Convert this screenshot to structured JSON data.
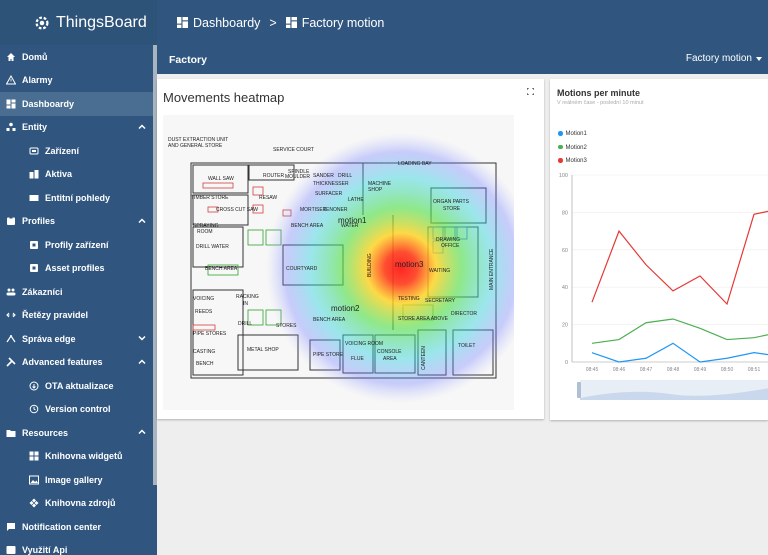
{
  "app": {
    "title": "ThingsBoard"
  },
  "breadcrumb": {
    "first": "Dashboardy",
    "separator": ">",
    "second": "Factory motion"
  },
  "colors": {
    "sidebar": "#305680",
    "active_item": "#4a6e92",
    "heat_red": "#ff2a2a",
    "motion1": "#2196f3",
    "motion2": "#4caf50",
    "motion3": "#e53935"
  },
  "sidebar": {
    "items": [
      {
        "label": "Domů",
        "icon": "home-icon"
      },
      {
        "label": "Alarmy",
        "icon": "warning-icon"
      },
      {
        "label": "Dashboardy",
        "icon": "dashboard-icon",
        "active": true
      },
      {
        "label": "Entity",
        "icon": "entity-icon",
        "expanded": true
      },
      {
        "label": "Zařízení",
        "icon": "device-icon",
        "sub": true
      },
      {
        "label": "Aktiva",
        "icon": "asset-icon",
        "sub": true
      },
      {
        "label": "Entitní pohledy",
        "icon": "entity-view-icon",
        "sub": true
      },
      {
        "label": "Profiles",
        "icon": "profiles-icon",
        "expanded": true
      },
      {
        "label": "Profily zařízení",
        "icon": "device-profile-icon",
        "sub": true
      },
      {
        "label": "Asset profiles",
        "icon": "asset-profile-icon",
        "sub": true
      },
      {
        "label": "Zákazníci",
        "icon": "customers-icon"
      },
      {
        "label": "Řetězy pravidel",
        "icon": "rule-chain-icon"
      },
      {
        "label": "Správa edge",
        "icon": "edge-icon",
        "collapsed": true
      },
      {
        "label": "Advanced features",
        "icon": "tools-icon",
        "expanded": true
      },
      {
        "label": "OTA aktualizace",
        "icon": "ota-icon",
        "sub": true
      },
      {
        "label": "Version control",
        "icon": "history-icon",
        "sub": true
      },
      {
        "label": "Resources",
        "icon": "folder-icon",
        "expanded": true
      },
      {
        "label": "Knihovna widgetů",
        "icon": "widgets-icon",
        "sub": true
      },
      {
        "label": "Image gallery",
        "icon": "image-icon",
        "sub": true
      },
      {
        "label": "Knihovna zdrojů",
        "icon": "resources-icon",
        "sub": true
      },
      {
        "label": "Notification center",
        "icon": "notification-icon"
      },
      {
        "label": "Využití Api",
        "icon": "api-icon"
      }
    ]
  },
  "dashboard": {
    "state_title": "Factory",
    "state_select": "Factory motion"
  },
  "heatmap": {
    "title": "Movements heatmap",
    "labels": {
      "dust": "DUST EXTRACTION UNIT",
      "dust2": "AND GENERAL STORE",
      "service": "SERVICE COURT",
      "loading": "LOADING BAY",
      "timber": "TIMBER STORE",
      "wall_saw": "WALL SAW",
      "resaw": "RESAW",
      "router": "ROUTER",
      "spindle": "SPINDLE",
      "sander": "SANDER",
      "drill": "DRILL",
      "moulder": "MOULDER",
      "thicknesser": "THICKNESSER",
      "machine": "MACHINE",
      "shop": "SHOP",
      "surfacer": "SURFACER",
      "lathe": "LATHE",
      "cross_cut": "CROSS CUT SAW",
      "mortiser": "MORTISER",
      "tenoner": "TENONER",
      "organ": "ORGAN PARTS",
      "store": "STORE",
      "spraying": "SPRAYING",
      "room": "ROOM",
      "bench_area": "BENCH AREA",
      "drill_water": "DRILL WATER",
      "courtyard": "COURTYARD",
      "building": "BUILDING",
      "drawing": "DRAWING",
      "office": "OFFICE",
      "waiting": "WAITING",
      "main_entrance": "MAIN ENTRANCE",
      "voicing": "VOICING",
      "reeds": "REEDS",
      "racking": "RACKING",
      "in": "IN",
      "stores": "STORES",
      "testing": "TESTING",
      "secretary": "SECRETARY",
      "director": "DIRECTOR",
      "pipe_stores": "PIPE STORES",
      "casting": "CASTING",
      "bench": "BENCH",
      "metal_shop": "METAL SHOP",
      "pipe_store": "PIPE STORE",
      "voicing_room": "VOICING ROOM",
      "flue": "FLUE",
      "console": "CONSOLE",
      "area": "AREA",
      "canteen": "CANTEEN",
      "toilet": "TOILET",
      "store_area": "STORE AREA ABOVE",
      "water": "WATER",
      "drill2": "DRILL"
    },
    "markers": {
      "m1": "motion1",
      "m2": "motion2",
      "m3": "motion3"
    }
  },
  "chart_data": {
    "type": "line",
    "title": "Motions per minute",
    "subtitle": "V reálném čase - poslední 10 minut",
    "x": [
      "08:45",
      "08:46",
      "08:47",
      "08:48",
      "08:49",
      "08:50",
      "08:51"
    ],
    "ylim": [
      0,
      100
    ],
    "yticks": [
      0,
      20,
      40,
      60,
      80,
      100
    ],
    "legend_position": "top-left",
    "series": [
      {
        "name": "Motion1",
        "color": "#2196f3",
        "values": [
          5,
          0,
          2,
          10,
          0,
          2,
          5,
          3
        ]
      },
      {
        "name": "Motion2",
        "color": "#4caf50",
        "values": [
          10,
          12,
          21,
          23,
          18,
          12,
          13,
          16
        ]
      },
      {
        "name": "Motion3",
        "color": "#e53935",
        "values": [
          32,
          70,
          52,
          38,
          46,
          31,
          79,
          82
        ]
      }
    ]
  }
}
